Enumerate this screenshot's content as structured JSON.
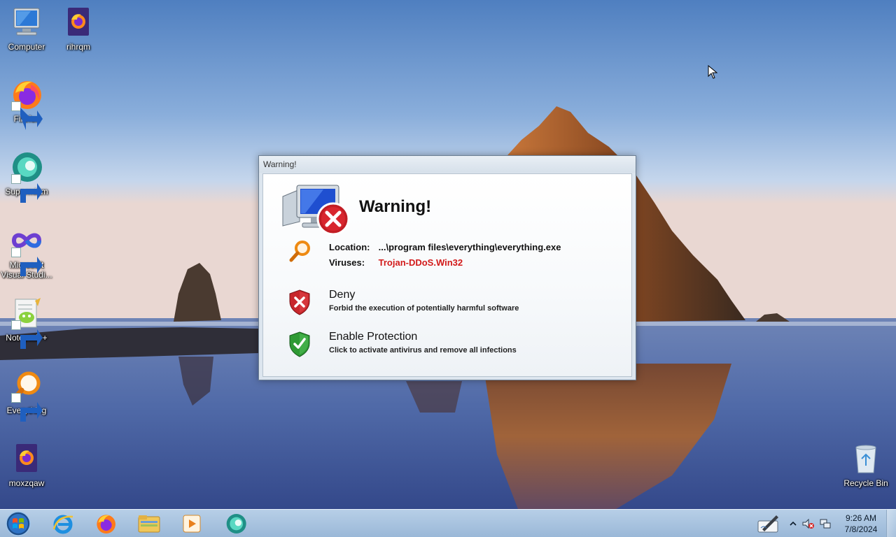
{
  "desktop": {
    "icons": [
      {
        "id": "computer",
        "label": "Computer"
      },
      {
        "id": "rihrqm",
        "label": "rihrqm"
      },
      {
        "id": "firefox",
        "label": "Firefox"
      },
      {
        "id": "supermium",
        "label": "Supermium"
      },
      {
        "id": "visual-studio",
        "label": "Microsoft\nVisual Studi..."
      },
      {
        "id": "notepadpp",
        "label": "Notepad++"
      },
      {
        "id": "everything",
        "label": "Everything"
      },
      {
        "id": "moxzqaw",
        "label": "moxzqaw"
      },
      {
        "id": "recycle-bin",
        "label": "Recycle Bin"
      }
    ]
  },
  "dialog": {
    "title": "Warning!",
    "heading": "Warning!",
    "location_label": "Location:",
    "location_value": "...\\program files\\everything\\everything.exe",
    "viruses_label": "Viruses:",
    "viruses_value": "Trojan-DDoS.Win32",
    "deny_title": "Deny",
    "deny_desc": "Forbid the execution of potentially harmful software",
    "enable_title": "Enable Protection",
    "enable_desc": "Click to activate antivirus and remove all infections"
  },
  "taskbar": {
    "pinned": [
      "internet-explorer-icon",
      "firefox-icon",
      "file-explorer-icon",
      "media-player-icon",
      "supermium-icon"
    ],
    "clock_time": "9:26 AM",
    "clock_date": "7/8/2024"
  },
  "colors": {
    "virus_red": "#d21919",
    "deny_shield": "#c8262b",
    "enable_shield": "#2e9a34",
    "taskbar": "#b0c9e4"
  }
}
